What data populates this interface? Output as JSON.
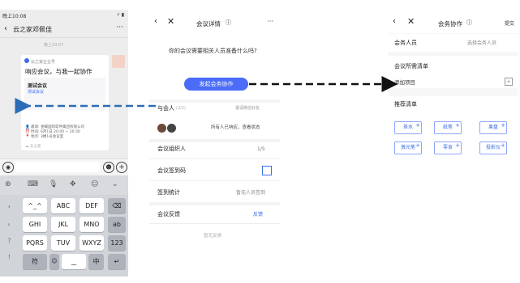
{
  "colors": {
    "accent": "#4a6cf7",
    "arrow_blue": "#2b6cb8",
    "arrow_black": "#111111"
  },
  "wechat": {
    "status_time": "晚上10:08",
    "status_right": "⚡ ▮",
    "title": "云之家邓佩佳",
    "back_icon": "chevron-left-icon",
    "more": "···",
    "time": "晚上10:07",
    "card": {
      "org": "云之家企业号",
      "title": "响应会议，与我一起协作",
      "preview_name": "测试会议",
      "preview_sub": "测试会议",
      "info": [
        "👤 邀请: 金蝶国际软件集团有限公司",
        "⏰ 时间: 6月1日  20:00 ~ 20:30",
        "📍 地点: 3楼1号会议室"
      ],
      "footer": "☁ 云之家"
    },
    "keyboard": {
      "toolbar": [
        "⊛",
        "⌨",
        "🎙",
        "✥",
        "☺",
        "⌄"
      ],
      "side": [
        "，",
        "。",
        "？",
        "！"
      ],
      "rows": [
        [
          "^_^",
          "ABC",
          "DEF"
        ],
        [
          "GHI",
          "JKL",
          "MNO"
        ],
        [
          "PQRS",
          "TUV",
          "WXYZ"
        ]
      ],
      "right": [
        "⌫",
        "ab",
        "123"
      ],
      "bottom": [
        "符",
        "☺",
        "‿",
        "中",
        "↵"
      ]
    },
    "input": {
      "voice": "◉",
      "emoji": "☻",
      "plus": "+"
    }
  },
  "meeting": {
    "title": "会议详情",
    "info_icon": "ⓘ",
    "more": "···",
    "ask": "你的会议需要相关人员准备什么吗?",
    "start_button": "发起会务协作",
    "attendees_label": "与会人",
    "attendees_count": "(2/2)",
    "invite": "邀请微信好友",
    "confirmed": "所有人已响应，查看状态",
    "organizer_label": "会议组织人",
    "organizer_value": "1/5",
    "signin_code": "会议签到码",
    "signin_stats": "签到统计",
    "signin_none": "暂无人员签到",
    "feedback_label": "会议反馈",
    "feedback_btn": "反馈",
    "no_feedback": "暂无反馈"
  },
  "collab": {
    "title": "会务协作",
    "submit": "提交",
    "staff_label": "会务人员",
    "staff_select": "选择会务人员",
    "list_label": "会议所需清单",
    "add_item": "添加项目",
    "recommend_label": "推荐清单",
    "tags": [
      "茶水",
      "纸笔",
      "果盘",
      "激光笔",
      "零食",
      "投影仪"
    ]
  }
}
